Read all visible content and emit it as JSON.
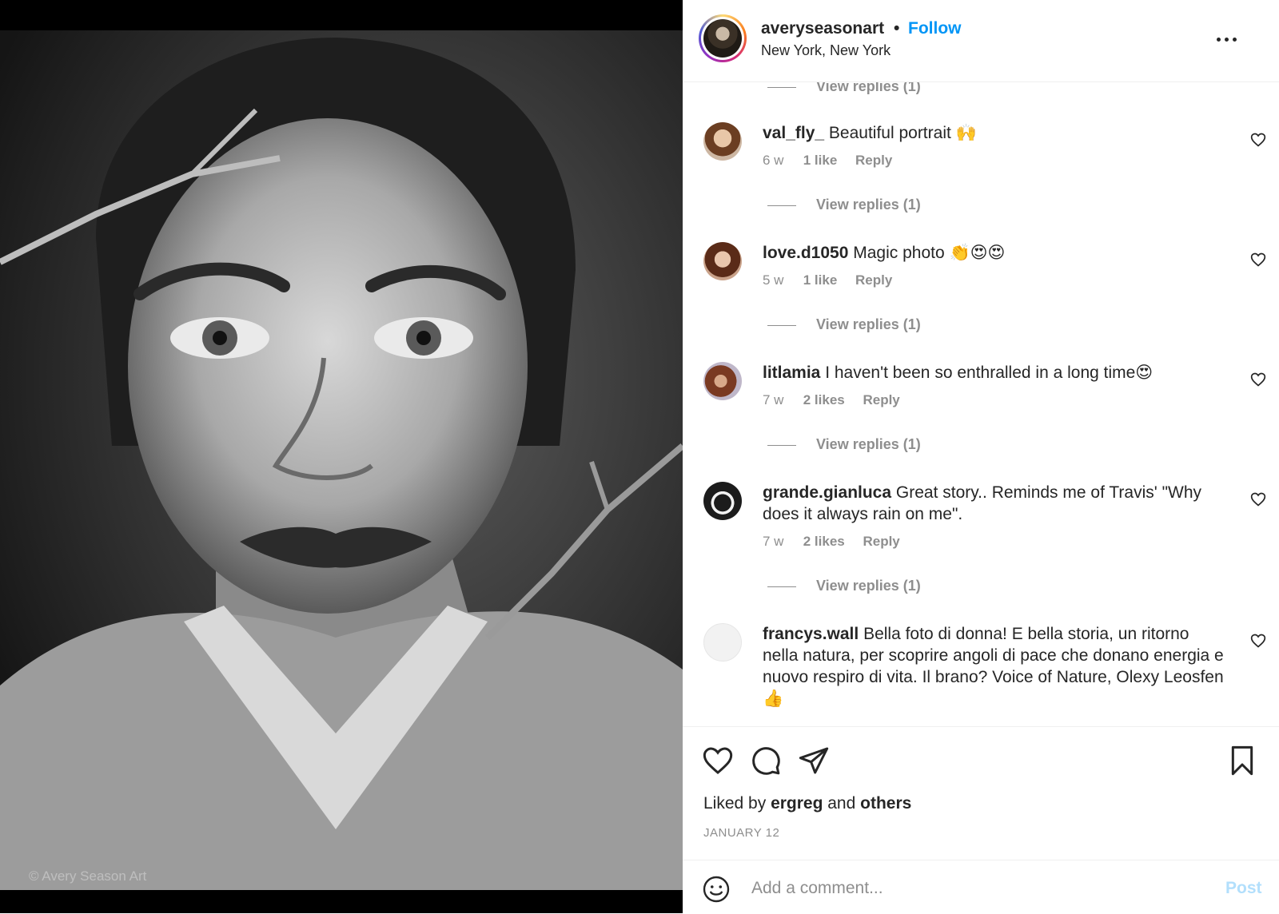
{
  "photo": {
    "watermark": "© Avery Season Art"
  },
  "header": {
    "username": "averyseasonart",
    "separator": "•",
    "follow_label": "Follow",
    "location": "New York, New York",
    "more_icon": "more-horizontal-icon"
  },
  "top_view_replies": "View replies (1)",
  "comments": [
    {
      "username": "val_fly_",
      "text": " Beautiful portrait 🙌",
      "time": "6 w",
      "likes": "1 like",
      "reply": "Reply",
      "view_replies": "View replies (1)"
    },
    {
      "username": "love.d1050",
      "text": " Magic photo 👏😍😍",
      "time": "5 w",
      "likes": "1 like",
      "reply": "Reply",
      "view_replies": "View replies (1)"
    },
    {
      "username": "litlamia",
      "text": " I haven't been so enthralled in a long time😍",
      "time": "7 w",
      "likes": "2 likes",
      "reply": "Reply",
      "view_replies": "View replies (1)"
    },
    {
      "username": "grande.gianluca",
      "text": " Great story.. Reminds me of Travis' \"Why does it always rain on me\".",
      "time": "7 w",
      "likes": "2 likes",
      "reply": "Reply",
      "view_replies": "View replies (1)"
    },
    {
      "username": "francys.wall",
      "text": " Bella foto di donna! E bella storia, un ritorno nella natura, per scoprire angoli di pace che donano energia e nuovo respiro di vita. Il brano? Voice of Nature, Olexy Leosfen 👍"
    }
  ],
  "actions": {
    "icons": [
      "heart-icon",
      "comment-icon",
      "share-icon",
      "bookmark-icon"
    ],
    "liked_by_prefix": "Liked by ",
    "liked_by_user": "ergreg",
    "liked_by_and": " and ",
    "liked_by_others": "others",
    "date": "JANUARY 12"
  },
  "add_comment": {
    "placeholder": "Add a comment...",
    "post_label": "Post"
  },
  "colors": {
    "link_blue": "#0095f6",
    "muted": "#8e8e8e",
    "post_disabled": "#b2dffc",
    "text": "#262626"
  }
}
